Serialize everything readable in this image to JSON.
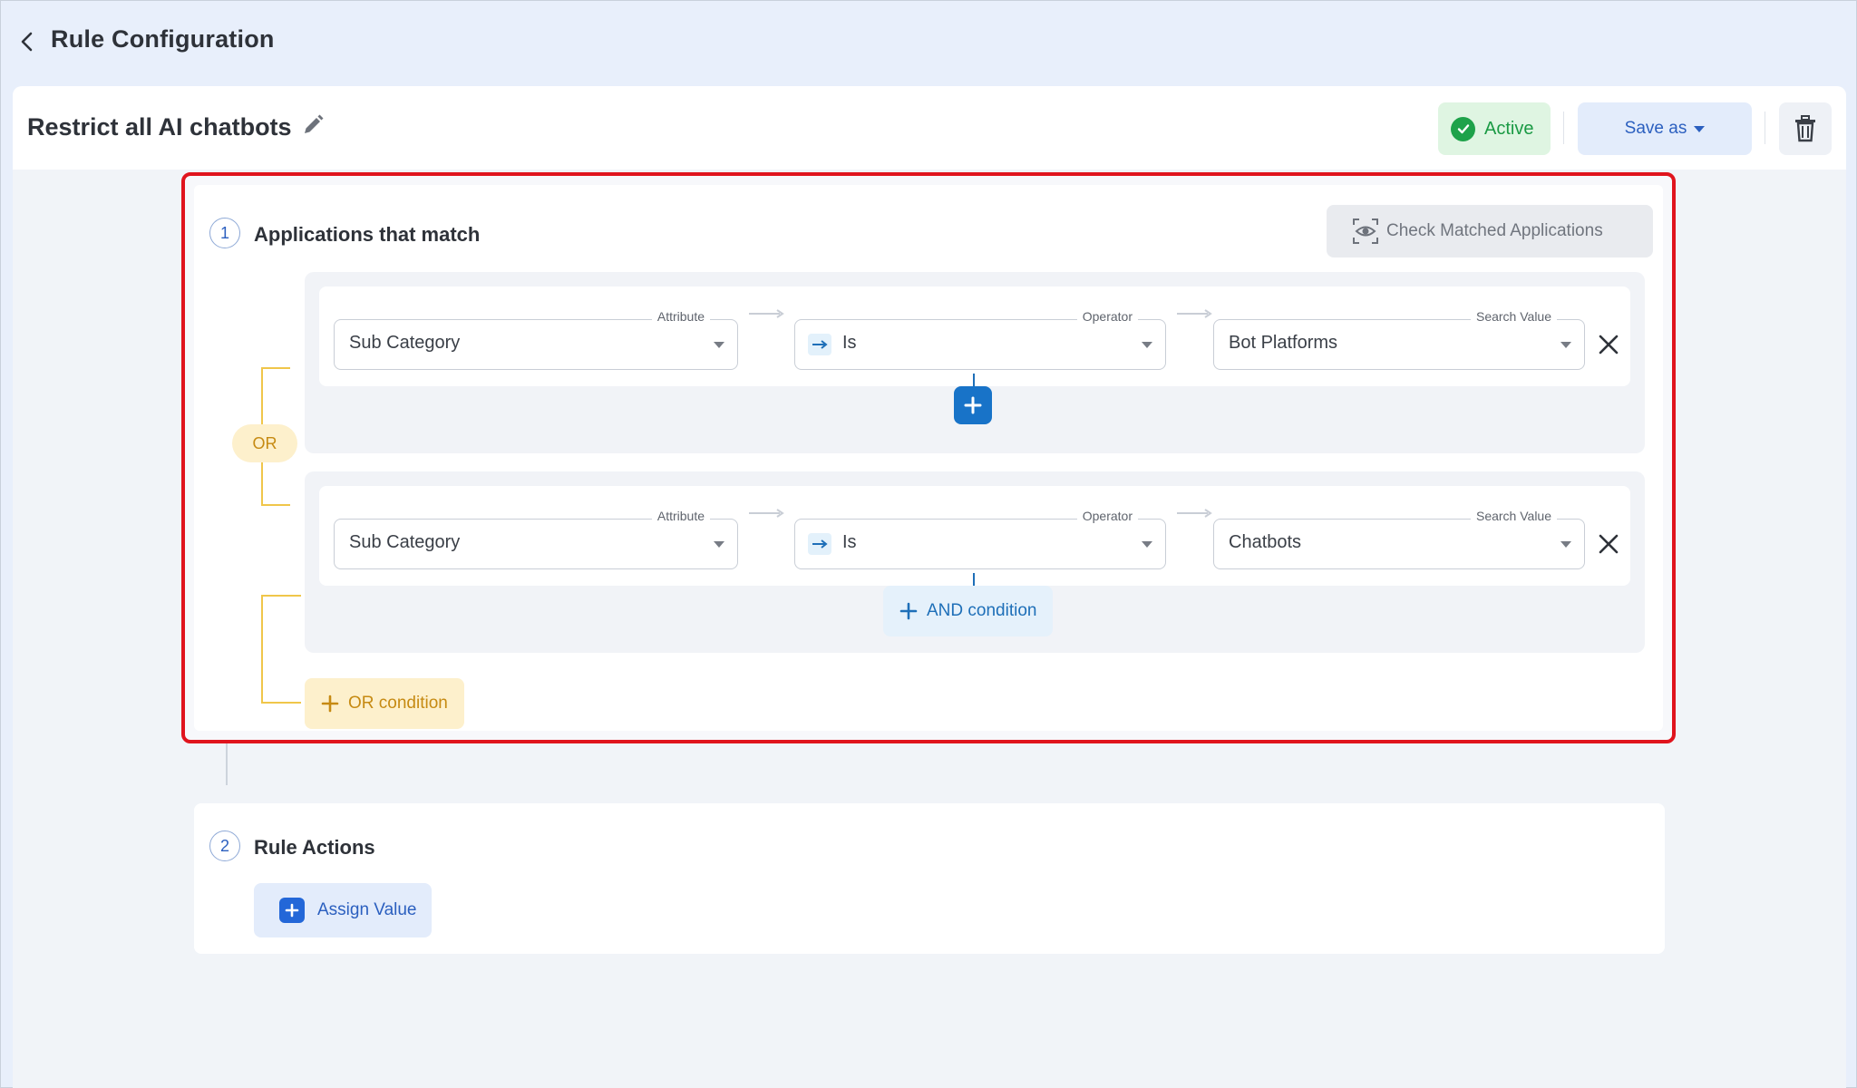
{
  "header": {
    "title": "Rule Configuration"
  },
  "rule": {
    "name": "Restrict all AI chatbots",
    "status": "Active",
    "save_label": "Save as"
  },
  "section1": {
    "number": "1",
    "title": "Applications that match",
    "check_button": "Check Matched Applications",
    "or_label": "OR",
    "or_condition_label": "OR condition",
    "and_condition_label": "AND condition",
    "groups": [
      {
        "attribute_legend": "Attribute",
        "attribute": "Sub Category",
        "operator_legend": "Operator",
        "operator": "Is",
        "value_legend": "Search Value",
        "value": "Bot Platforms"
      },
      {
        "attribute_legend": "Attribute",
        "attribute": "Sub Category",
        "operator_legend": "Operator",
        "operator": "Is",
        "value_legend": "Search Value",
        "value": "Chatbots"
      }
    ]
  },
  "section2": {
    "number": "2",
    "title": "Rule Actions",
    "assign_label": "Assign Value"
  },
  "colors": {
    "accent": "#2b5fbf",
    "active_green": "#1ea24a",
    "or_yellow": "#c68a12",
    "highlight_red": "#e0141d"
  }
}
